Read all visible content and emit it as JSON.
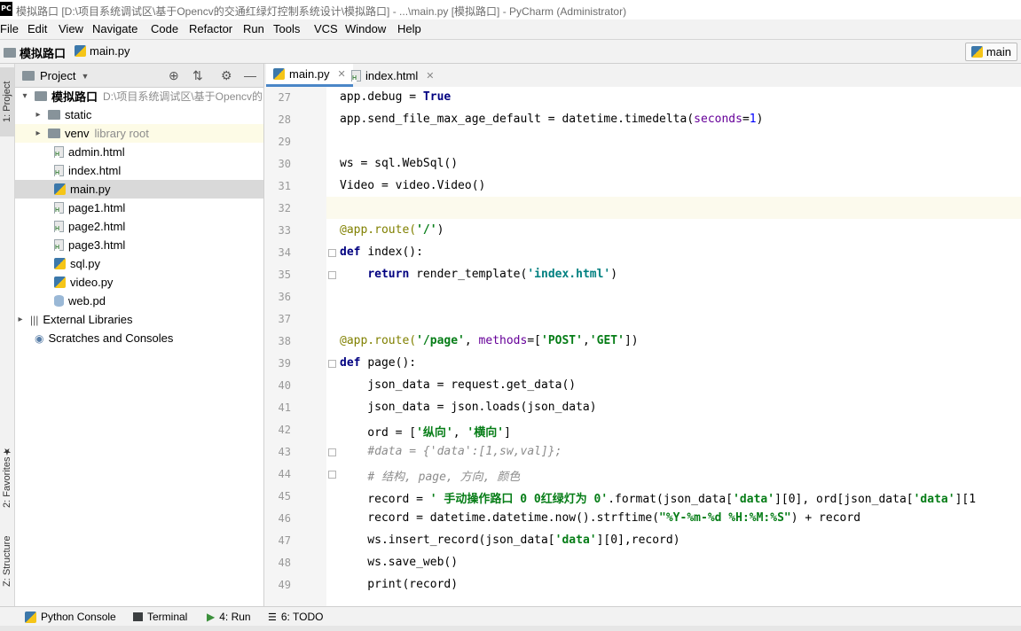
{
  "window": {
    "app_icon": "PC",
    "title": "模拟路口 [D:\\项目系统调试区\\基于Opencv的交通红绿灯控制系统设计\\模拟路口] - ...\\main.py [模拟路口] - PyCharm (Administrator)"
  },
  "menu": [
    "File",
    "Edit",
    "View",
    "Navigate",
    "Code",
    "Refactor",
    "Run",
    "Tools",
    "VCS",
    "Window",
    "Help"
  ],
  "breadcrumb": {
    "project": "模拟路口",
    "file": "main.py"
  },
  "run_config": "main",
  "left_strip": {
    "project": "1: Project",
    "favorites": "2: Favorites",
    "structure": "Z: Structure"
  },
  "project_panel": {
    "title": "Project",
    "root": {
      "name": "模拟路口",
      "path": "D:\\项目系统调试区\\基于Opencv的"
    },
    "items": [
      {
        "label": "static"
      },
      {
        "label": "venv",
        "sub": "library root"
      },
      {
        "label": "admin.html"
      },
      {
        "label": "index.html"
      },
      {
        "label": "main.py"
      },
      {
        "label": "page1.html"
      },
      {
        "label": "page2.html"
      },
      {
        "label": "page3.html"
      },
      {
        "label": "sql.py"
      },
      {
        "label": "video.py"
      },
      {
        "label": "web.pd"
      }
    ],
    "external": "External Libraries",
    "scratches": "Scratches and Consoles"
  },
  "tabs": [
    {
      "label": "main.py",
      "active": true
    },
    {
      "label": "index.html",
      "active": false
    }
  ],
  "editor": {
    "line_numbers": [
      "27",
      "28",
      "29",
      "30",
      "31",
      "32",
      "33",
      "34",
      "35",
      "36",
      "37",
      "38",
      "39",
      "40",
      "41",
      "42",
      "43",
      "44",
      "45",
      "46",
      "47",
      "48",
      "49"
    ]
  },
  "bottom_tabs": [
    "Python Console",
    "Terminal",
    "4: Run",
    "6: TODO"
  ],
  "colors": {
    "accent": "#4a86c7",
    "current_line": "#fcfaed",
    "keyword": "#000080",
    "string": "#067d17"
  }
}
